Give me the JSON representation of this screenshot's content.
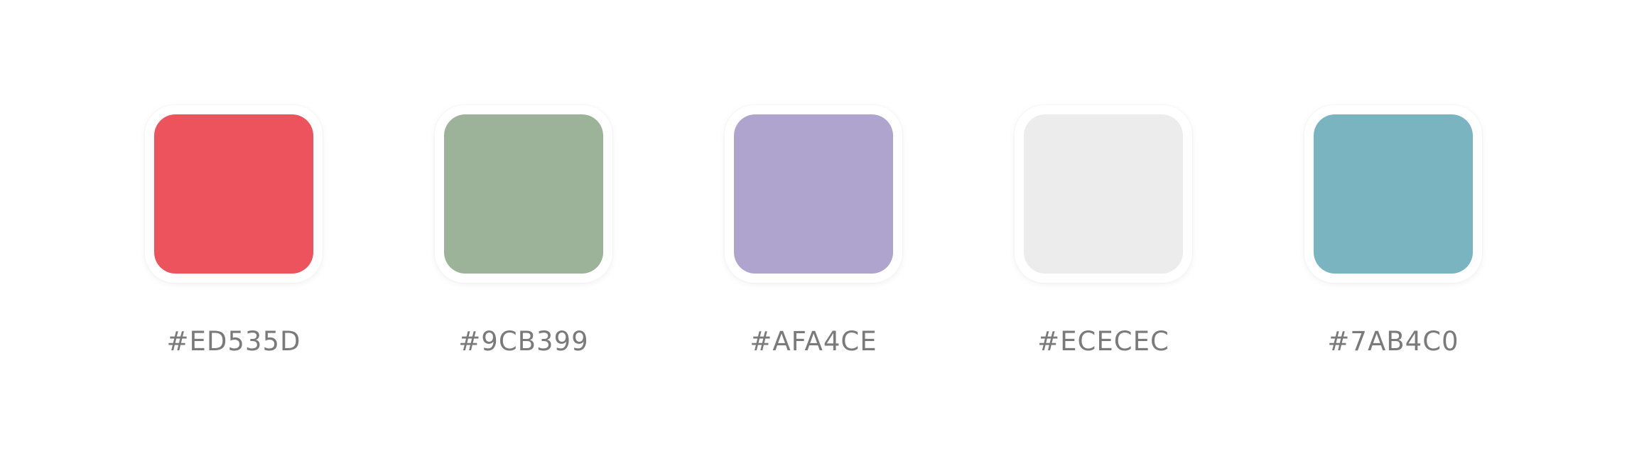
{
  "palette": {
    "swatches": [
      {
        "label": "#ED535D",
        "color": "#ED535D"
      },
      {
        "label": "#9CB399",
        "color": "#9CB399"
      },
      {
        "label": "#AFA4CE",
        "color": "#AFA4CE"
      },
      {
        "label": "#ECECEC",
        "color": "#ECECEC"
      },
      {
        "label": "#7AB4C0",
        "color": "#7AB4C0"
      }
    ]
  }
}
